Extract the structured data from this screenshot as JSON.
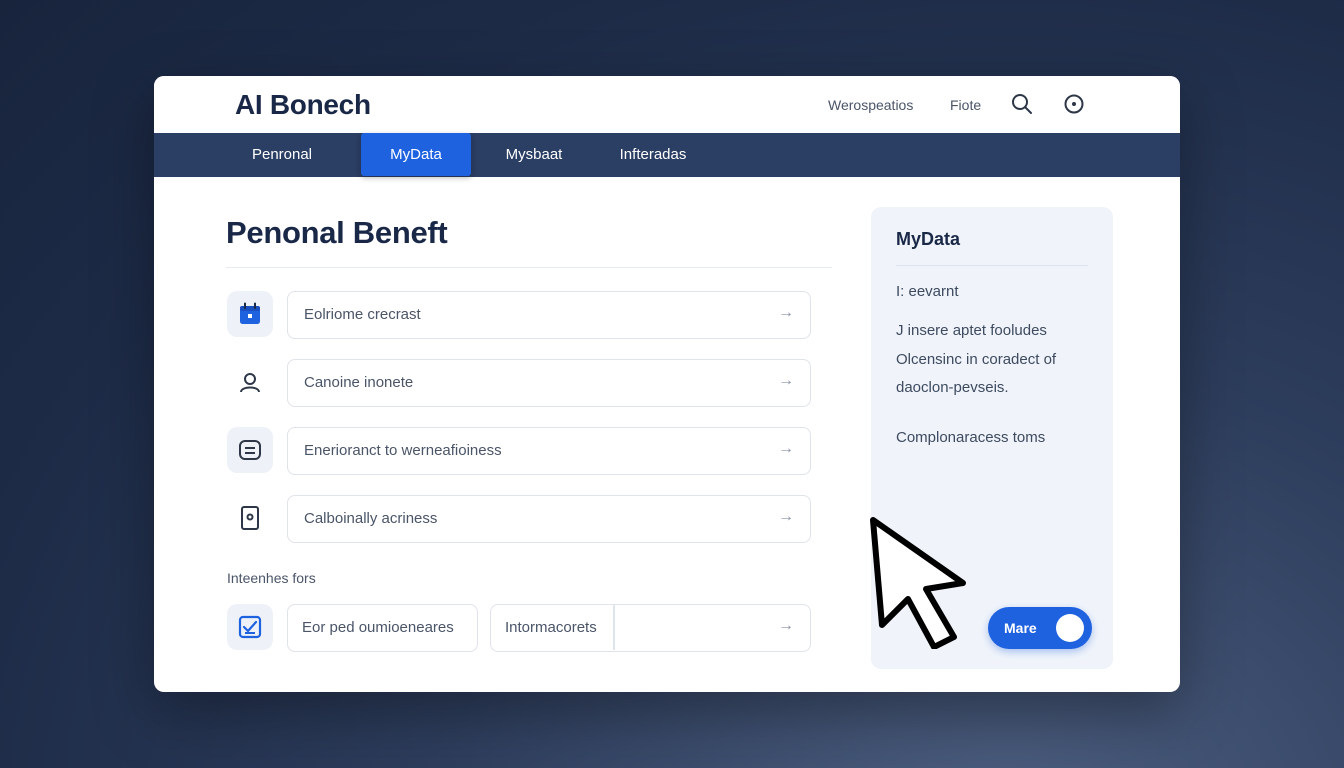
{
  "app": {
    "title": "AI Bonech"
  },
  "header": {
    "links": [
      "Werospeatios",
      "Fiote"
    ],
    "icons": [
      "search-icon",
      "info-icon"
    ]
  },
  "nav": {
    "tabs": [
      {
        "label": "Penronal",
        "active": false
      },
      {
        "label": "MyData",
        "active": true
      },
      {
        "label": "Mysbaat",
        "active": false
      },
      {
        "label": "Infteradas",
        "active": false
      }
    ]
  },
  "main": {
    "title": "Penonal Beneft",
    "rows": [
      {
        "icon": "calendar-icon",
        "label": "Eolriome crecrast",
        "arrow": "→"
      },
      {
        "icon": "user-icon",
        "label": "Canoine inonete",
        "arrow": "→"
      },
      {
        "icon": "chat-icon",
        "label": "Enerioranct to werneafioiness",
        "arrow": "→"
      },
      {
        "icon": "device-icon",
        "label": "Calboinally acriness",
        "arrow": "→"
      }
    ],
    "section_label": "Inteenhes fors",
    "bottom_row": {
      "icon": "checklist-icon",
      "field1": "Eor ped oumioeneares",
      "field2": "Intormacorets",
      "arrow": "→"
    }
  },
  "side_panel": {
    "title": "MyData",
    "line1": "I: eevarnt",
    "paragraph": "J insere aptet fooludes Olcensinc in coradect of daoclon-pevseis.",
    "line2": "Complonaracess toms",
    "toggle": {
      "label": "Mare",
      "on": true
    }
  },
  "colors": {
    "accent": "#1f62e0",
    "nav_bg": "#2b3e63",
    "title": "#1a2847",
    "panel_bg": "#f0f4fa"
  }
}
